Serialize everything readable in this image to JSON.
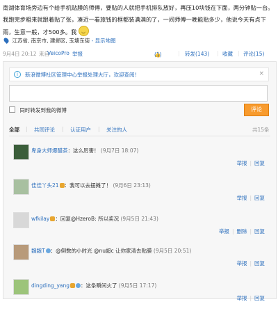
{
  "post": {
    "text": "南湖体育场旁边有个给手机贴膜的师傅，要贴的人就把手机排队放好，再压10块钱在下面，两分钟贴一台。我跑完步粗来就跟着贴了张，凑近一看旅钱的框都装满满的了，一间师傅一晚能贴多少，他说今天有点下雨，生意一般，才500多。我",
    "emoji": "smile-emoji",
    "location": "江苏省, 南京市, 建邺区, 玉塘东街",
    "map_link": "- 显示地图",
    "time": "9月4日 20:12",
    "source_prefix": "来自",
    "source": "VeicoPro",
    "report": "举报",
    "like_count": "(1)",
    "forward": "转发(143)",
    "favorite": "收藏",
    "comment": "评论(15)"
  },
  "notice": {
    "text": "新浪微博社区管理中心举报处理大厅，欢迎查阅！",
    "close": "×"
  },
  "composer": {
    "checkbox_label": "同时转发到我的微博",
    "submit": "评论"
  },
  "filters": {
    "all": "全部",
    "mutual": "共同评论",
    "verified": "认证用户",
    "following": "关注的人",
    "total": "共15条"
  },
  "comments": [
    {
      "name": "卑身大师爆醋茶",
      "text": "：这么厉害！",
      "time": "(9月7日 18:07)",
      "report": "举报",
      "reply": "回复"
    },
    {
      "name": "佳佳丫头21",
      "text": "：我可以去摆摊了！",
      "time": "(9月6日 23:13)",
      "report": "举报",
      "reply": "回复"
    },
    {
      "name": "wfkilay",
      "text": "：回复@HzeroB: 所以奖况",
      "time": "(9月5日 21:43)",
      "report": "举报",
      "reply": "回复",
      "delete": "删除"
    },
    {
      "name": "魏魏T",
      "text": "：@倒数的小时光 @nu超c 让你家清去贴膜",
      "time": "(9月5日 20:51)",
      "report": "举报",
      "reply": "回复"
    },
    {
      "name": "dingding_yang",
      "text": "：这条瞬间火了",
      "time": "(9月5日 17:17)",
      "report": "举报",
      "reply": "回复"
    }
  ],
  "colors": {
    "link": "#2c6fbd",
    "accent": "#f89b2e"
  }
}
